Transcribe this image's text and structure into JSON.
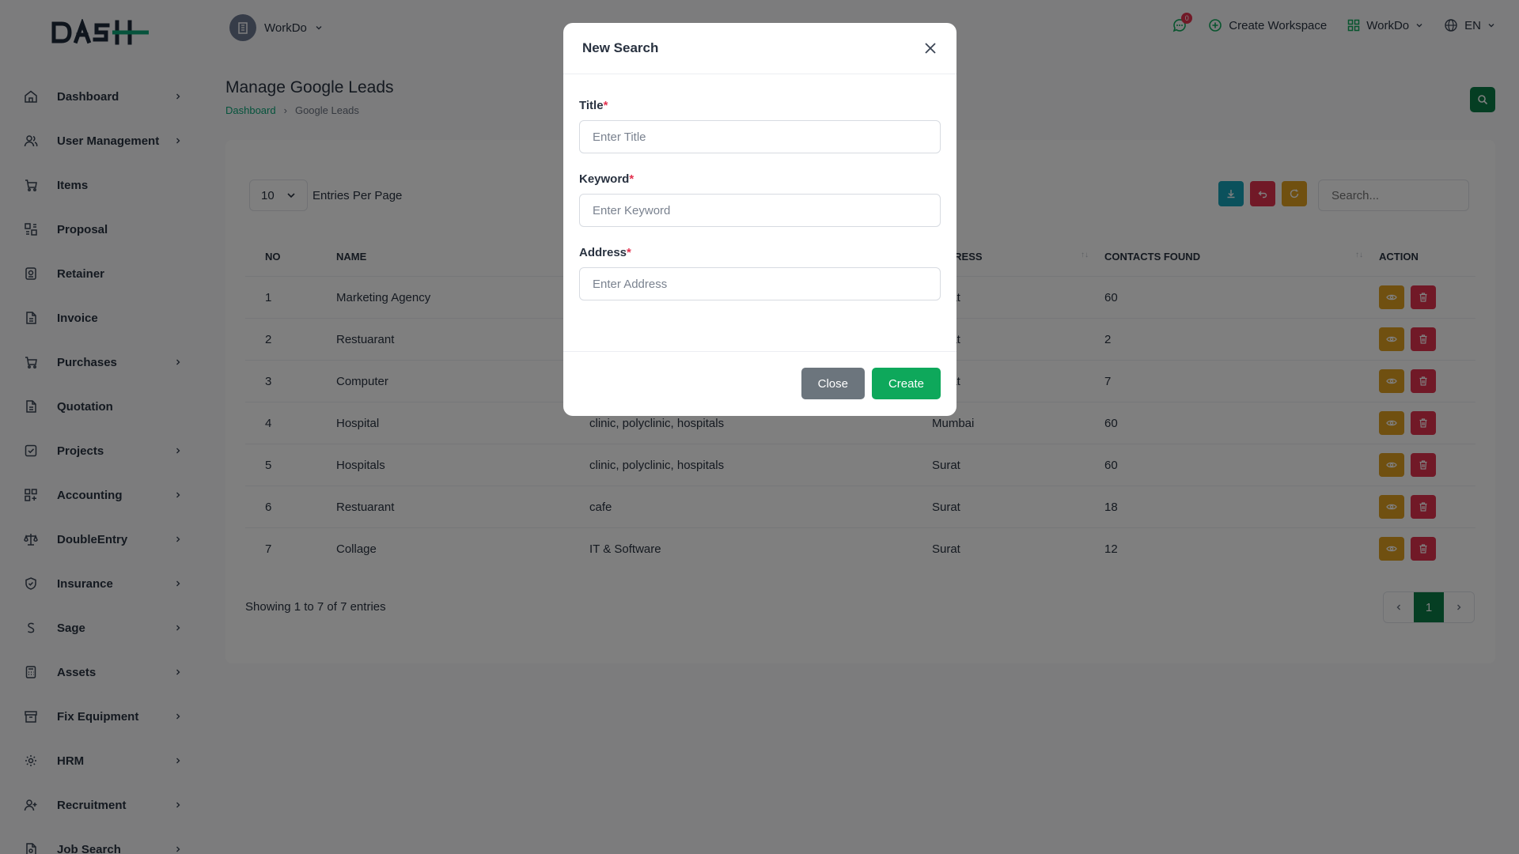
{
  "brand": {
    "logo_text": "DASH"
  },
  "sidebar": {
    "items": [
      {
        "label": "Dashboard",
        "icon": "home-icon",
        "has_children": true
      },
      {
        "label": "User Management",
        "icon": "users-icon",
        "has_children": true
      },
      {
        "label": "Items",
        "icon": "cart-icon",
        "has_children": false
      },
      {
        "label": "Proposal",
        "icon": "proposal-icon",
        "has_children": false
      },
      {
        "label": "Retainer",
        "icon": "retainer-icon",
        "has_children": false
      },
      {
        "label": "Invoice",
        "icon": "file-icon",
        "has_children": false
      },
      {
        "label": "Purchases",
        "icon": "cart-icon",
        "has_children": true
      },
      {
        "label": "Quotation",
        "icon": "file-icon",
        "has_children": false
      },
      {
        "label": "Projects",
        "icon": "check-square-icon",
        "has_children": true
      },
      {
        "label": "Accounting",
        "icon": "grid-icon",
        "has_children": true
      },
      {
        "label": "DoubleEntry",
        "icon": "scale-icon",
        "has_children": true
      },
      {
        "label": "Insurance",
        "icon": "shield-icon",
        "has_children": true
      },
      {
        "label": "Sage",
        "icon": "s-letter-icon",
        "has_children": true
      },
      {
        "label": "Assets",
        "icon": "calculator-icon",
        "has_children": true
      },
      {
        "label": "Fix Equipment",
        "icon": "archive-icon",
        "has_children": true
      },
      {
        "label": "HRM",
        "icon": "gear-people-icon",
        "has_children": true
      },
      {
        "label": "Recruitment",
        "icon": "user-plus-icon",
        "has_children": true
      },
      {
        "label": "Job Search",
        "icon": "file-search-icon",
        "has_children": true
      }
    ]
  },
  "topbar": {
    "workspace": "WorkDo",
    "notification_count": "0",
    "create_workspace": "Create Workspace",
    "company": "WorkDo",
    "language": "EN"
  },
  "page": {
    "title": "Manage Google Leads",
    "breadcrumb": {
      "home": "Dashboard",
      "current": "Google Leads"
    }
  },
  "table": {
    "entries_value": "10",
    "entries_label": "Entries Per Page",
    "search_placeholder": "Search...",
    "columns": {
      "no": "NO",
      "name": "NAME",
      "keyword": "",
      "address": "ADDRESS",
      "contacts": "CONTACTS FOUND",
      "action": "ACTION"
    },
    "rows": [
      {
        "no": "1",
        "name": "Marketing Agency",
        "keyword": "",
        "address": "Surat",
        "contacts": "60"
      },
      {
        "no": "2",
        "name": "Restuarant",
        "keyword": "",
        "address": "Surat",
        "contacts": "2"
      },
      {
        "no": "3",
        "name": "Computer",
        "keyword": "",
        "address": "Surat",
        "contacts": "7"
      },
      {
        "no": "4",
        "name": "Hospital",
        "keyword": "clinic, polyclinic, hospitals",
        "address": "Mumbai",
        "contacts": "60"
      },
      {
        "no": "5",
        "name": "Hospitals",
        "keyword": "clinic, polyclinic, hospitals",
        "address": "Surat",
        "contacts": "60"
      },
      {
        "no": "6",
        "name": "Restuarant",
        "keyword": "cafe",
        "address": "Surat",
        "contacts": "18"
      },
      {
        "no": "7",
        "name": "Collage",
        "keyword": "IT & Software",
        "address": "Surat",
        "contacts": "12"
      }
    ],
    "showing": "Showing 1 to 7 of 7 entries",
    "current_page": "1"
  },
  "modal": {
    "title": "New Search",
    "fields": [
      {
        "label": "Title",
        "required": "*",
        "placeholder": "Enter Title",
        "value": ""
      },
      {
        "label": "Keyword",
        "required": "*",
        "placeholder": "Enter Keyword",
        "value": ""
      },
      {
        "label": "Address",
        "required": "*",
        "placeholder": "Enter Address",
        "value": ""
      }
    ],
    "close_label": "Close",
    "create_label": "Create"
  },
  "colors": {
    "primary": "#0a7d47",
    "create_green": "#0ea85b",
    "danger": "#e3324f",
    "warning": "#e0a020",
    "info": "#17a2b8",
    "close_gray": "#6c757d"
  }
}
